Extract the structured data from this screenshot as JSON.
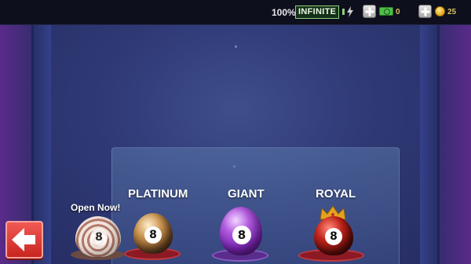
{
  "status_bar": {
    "battery_percent": "100%",
    "energy_label": "INFINITE",
    "cash_count": "0",
    "coin_count": "25"
  },
  "shop": {
    "open_now_label": "Open Now!",
    "eggs": [
      {
        "label": "PLATINUM",
        "ball_number": "8"
      },
      {
        "label": "GIANT",
        "ball_number": "8"
      },
      {
        "label": "ROYAL",
        "ball_number": "8"
      }
    ],
    "free_egg_ball_number": "8"
  },
  "colors": {
    "accent_red": "#d9342c",
    "energy_green": "#8fd17a",
    "currency_gold": "#d8c060",
    "giant_purple": "#9b3fd6"
  },
  "icons": {
    "back": "arrow-left-icon",
    "energy": "lightning-bolt-icon",
    "cash": "cash-bill-icon",
    "coin": "coin-icon",
    "add": "plus-icon",
    "crown": "crown-icon"
  }
}
